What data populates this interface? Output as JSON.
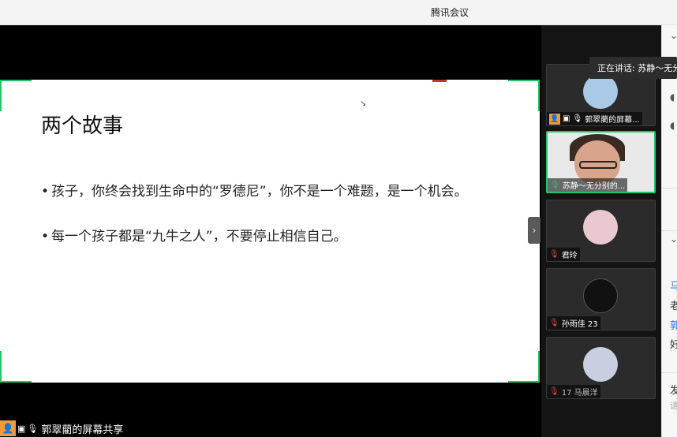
{
  "window": {
    "title": "腾讯会议"
  },
  "slide": {
    "title": "两个故事",
    "bullets": [
      "孩子，你终会找到生命中的“罗德尼”，你不是一个难题，是一个机会。",
      "每一个孩子都是“九牛之人”，不要停止相信自己。"
    ]
  },
  "share_label": {
    "text": "郭翠藺的屏幕共享"
  },
  "collapse_icon": "chevron-right-icon",
  "participants": [
    {
      "name": "郭翠藺的屏幕...",
      "status": "host",
      "avatar_color": "#a9c9e6"
    },
    {
      "name": "苏静～无分别的...",
      "status": "speaking",
      "avatar_color": "#d8a58c"
    },
    {
      "name": "君玲",
      "status": "muted",
      "avatar_color": "#e9c8cf"
    },
    {
      "name": "孙雨佳 23",
      "status": "muted",
      "avatar_color": "#111111"
    },
    {
      "name": "17  马晨洋",
      "status": "muted",
      "avatar_color": "#c9cfe0"
    }
  ],
  "tooltip": {
    "text": "正在讲话: 苏静～无分别"
  },
  "chat_panel": {
    "lines": [
      "马",
      "老",
      "郭",
      "好",
      "发",
      "请"
    ]
  },
  "colors": {
    "accent": "#29c36a",
    "host_badge": "#f29a3c",
    "muted": "#e24a4a"
  }
}
